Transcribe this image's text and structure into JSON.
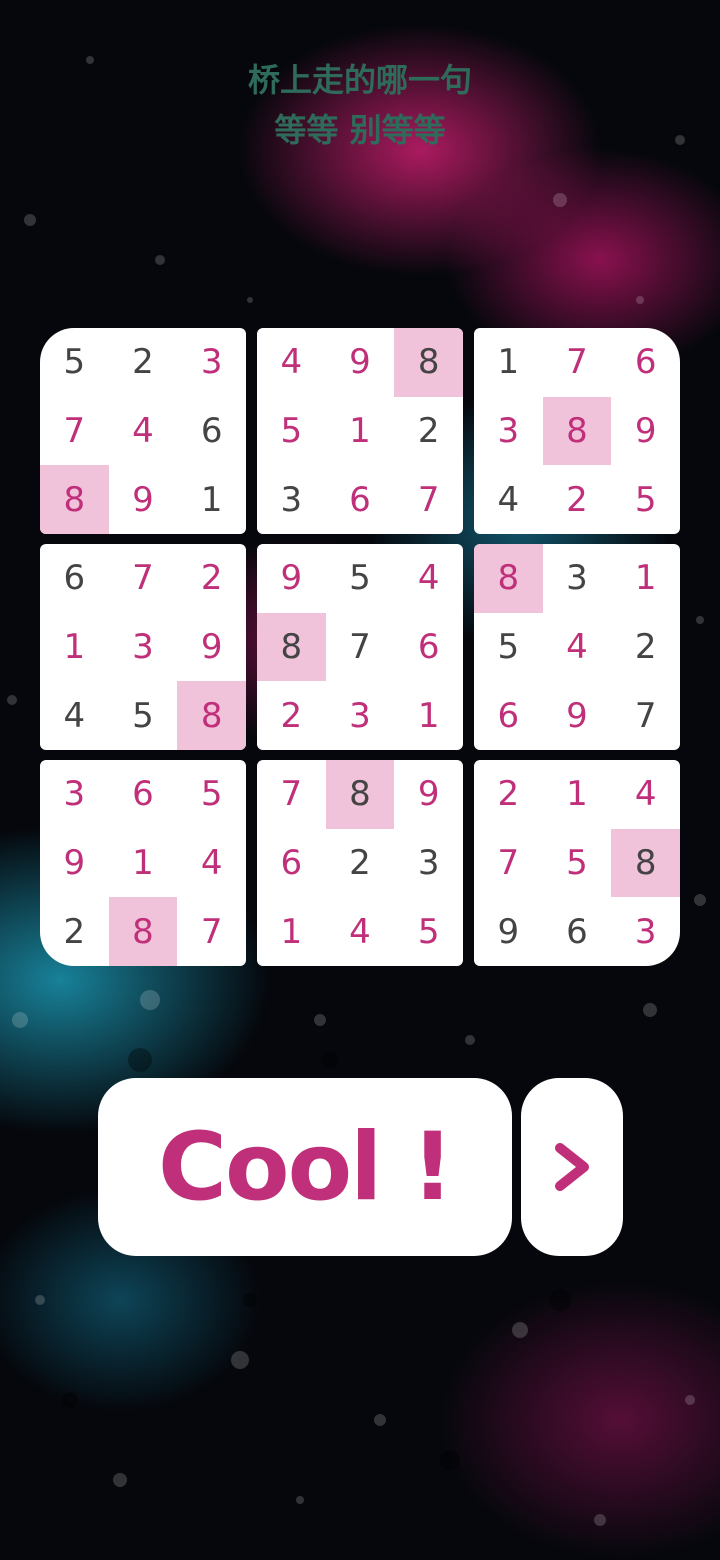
{
  "lyrics": {
    "line1": "桥上走的哪一句",
    "line2": "等等 别等等"
  },
  "colors": {
    "accent": "#c0307a",
    "highlight": "#f1c3db",
    "given_digit": "#444444"
  },
  "board": {
    "highlighted_digit": "8",
    "boxes": [
      [
        {
          "v": "5",
          "t": "given"
        },
        {
          "v": "2",
          "t": "given"
        },
        {
          "v": "3",
          "t": "user"
        },
        {
          "v": "7",
          "t": "user"
        },
        {
          "v": "4",
          "t": "user"
        },
        {
          "v": "6",
          "t": "given"
        },
        {
          "v": "8",
          "t": "user",
          "hl": true
        },
        {
          "v": "9",
          "t": "user"
        },
        {
          "v": "1",
          "t": "given"
        }
      ],
      [
        {
          "v": "4",
          "t": "user"
        },
        {
          "v": "9",
          "t": "user"
        },
        {
          "v": "8",
          "t": "given",
          "hl": true
        },
        {
          "v": "5",
          "t": "user"
        },
        {
          "v": "1",
          "t": "user"
        },
        {
          "v": "2",
          "t": "given"
        },
        {
          "v": "3",
          "t": "given"
        },
        {
          "v": "6",
          "t": "user"
        },
        {
          "v": "7",
          "t": "user"
        }
      ],
      [
        {
          "v": "1",
          "t": "given"
        },
        {
          "v": "7",
          "t": "user"
        },
        {
          "v": "6",
          "t": "user"
        },
        {
          "v": "3",
          "t": "user"
        },
        {
          "v": "8",
          "t": "user",
          "hl": true
        },
        {
          "v": "9",
          "t": "user"
        },
        {
          "v": "4",
          "t": "given"
        },
        {
          "v": "2",
          "t": "user"
        },
        {
          "v": "5",
          "t": "user"
        }
      ],
      [
        {
          "v": "6",
          "t": "given"
        },
        {
          "v": "7",
          "t": "user"
        },
        {
          "v": "2",
          "t": "user"
        },
        {
          "v": "1",
          "t": "user"
        },
        {
          "v": "3",
          "t": "user"
        },
        {
          "v": "9",
          "t": "user"
        },
        {
          "v": "4",
          "t": "given"
        },
        {
          "v": "5",
          "t": "given"
        },
        {
          "v": "8",
          "t": "user",
          "hl": true
        }
      ],
      [
        {
          "v": "9",
          "t": "user"
        },
        {
          "v": "5",
          "t": "given"
        },
        {
          "v": "4",
          "t": "user"
        },
        {
          "v": "8",
          "t": "given",
          "hl": true
        },
        {
          "v": "7",
          "t": "given"
        },
        {
          "v": "6",
          "t": "user"
        },
        {
          "v": "2",
          "t": "user"
        },
        {
          "v": "3",
          "t": "user"
        },
        {
          "v": "1",
          "t": "user"
        }
      ],
      [
        {
          "v": "8",
          "t": "user",
          "hl": true
        },
        {
          "v": "3",
          "t": "given"
        },
        {
          "v": "1",
          "t": "user"
        },
        {
          "v": "5",
          "t": "given"
        },
        {
          "v": "4",
          "t": "user"
        },
        {
          "v": "2",
          "t": "given"
        },
        {
          "v": "6",
          "t": "user"
        },
        {
          "v": "9",
          "t": "user"
        },
        {
          "v": "7",
          "t": "given"
        }
      ],
      [
        {
          "v": "3",
          "t": "user"
        },
        {
          "v": "6",
          "t": "user"
        },
        {
          "v": "5",
          "t": "user"
        },
        {
          "v": "9",
          "t": "user"
        },
        {
          "v": "1",
          "t": "user"
        },
        {
          "v": "4",
          "t": "user"
        },
        {
          "v": "2",
          "t": "given"
        },
        {
          "v": "8",
          "t": "user",
          "hl": true
        },
        {
          "v": "7",
          "t": "user"
        }
      ],
      [
        {
          "v": "7",
          "t": "user"
        },
        {
          "v": "8",
          "t": "given",
          "hl": true
        },
        {
          "v": "9",
          "t": "user"
        },
        {
          "v": "6",
          "t": "user"
        },
        {
          "v": "2",
          "t": "given"
        },
        {
          "v": "3",
          "t": "given"
        },
        {
          "v": "1",
          "t": "user"
        },
        {
          "v": "4",
          "t": "user"
        },
        {
          "v": "5",
          "t": "user"
        }
      ],
      [
        {
          "v": "2",
          "t": "user"
        },
        {
          "v": "1",
          "t": "user"
        },
        {
          "v": "4",
          "t": "user"
        },
        {
          "v": "7",
          "t": "user"
        },
        {
          "v": "5",
          "t": "user"
        },
        {
          "v": "8",
          "t": "given",
          "hl": true
        },
        {
          "v": "9",
          "t": "given"
        },
        {
          "v": "6",
          "t": "given"
        },
        {
          "v": "3",
          "t": "user"
        }
      ]
    ]
  },
  "actions": {
    "cool_label": "Cool !",
    "next_icon": "chevron-right-icon"
  }
}
